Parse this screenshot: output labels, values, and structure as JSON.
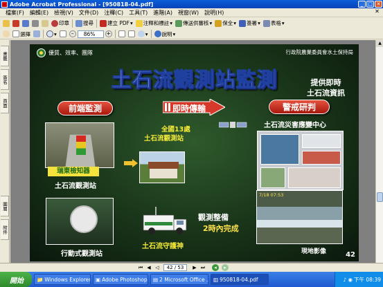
{
  "window": {
    "title": "Adobe Acrobat Professional - [950818-04.pdf]"
  },
  "menu": [
    "檔案(F)",
    "編輯(E)",
    "檢視(V)",
    "文件(D)",
    "注釋(C)",
    "工具(T)",
    "進階(A)",
    "視窗(W)",
    "說明(H)"
  ],
  "toolbar1": {
    "print": "印章",
    "search": "搜尋",
    "create_pdf": "建立 PDF",
    "comment": "注釋和標註",
    "review": "傳送供審核",
    "secure": "保全",
    "sign": "簽署",
    "forms": "表格"
  },
  "toolbar2": {
    "select": "選擇",
    "zoom": "86%",
    "help": "說明"
  },
  "leftnav": {
    "tabs": [
      "書籤",
      "簽名",
      "頁面",
      "圖層",
      "附件"
    ]
  },
  "slide": {
    "header_left": "優質、效率、團隊",
    "header_right": "行政院農業委員會水土保持局",
    "title": "土石流觀測站監測",
    "right_top": [
      "提供即時",
      "土石流資訊"
    ],
    "front_monitor": "前端監測",
    "transmit": "即時傳輸",
    "warning": "警戒研判",
    "national_13": [
      "全國13處",
      "土石流觀測站"
    ],
    "disaster_center": "土石流災害應變中心",
    "yellow_tag": "瑞東檢知器",
    "station_caption": "土石流觀測站",
    "mobile_caption": "行動式觀測站",
    "guardian_caption": "土石流守護神",
    "observe": [
      "觀測整備",
      "2時內完成"
    ],
    "site_caption": "現地影像",
    "site_stamp": "7/18 07:53",
    "slide_number": "42"
  },
  "navbar": {
    "page": "42 / 53"
  },
  "taskbar": {
    "start": "開始",
    "tasks": [
      "Windows Explorer",
      "Adobe Photoshop",
      "2 Microsoft Office ...",
      "950818-04.pdf"
    ],
    "clock": "下午 08:39"
  },
  "colors": {
    "accent_red": "#c8261a",
    "taskbar_blue": "#1f5ad0",
    "slide_green": "#1c3a1c"
  }
}
